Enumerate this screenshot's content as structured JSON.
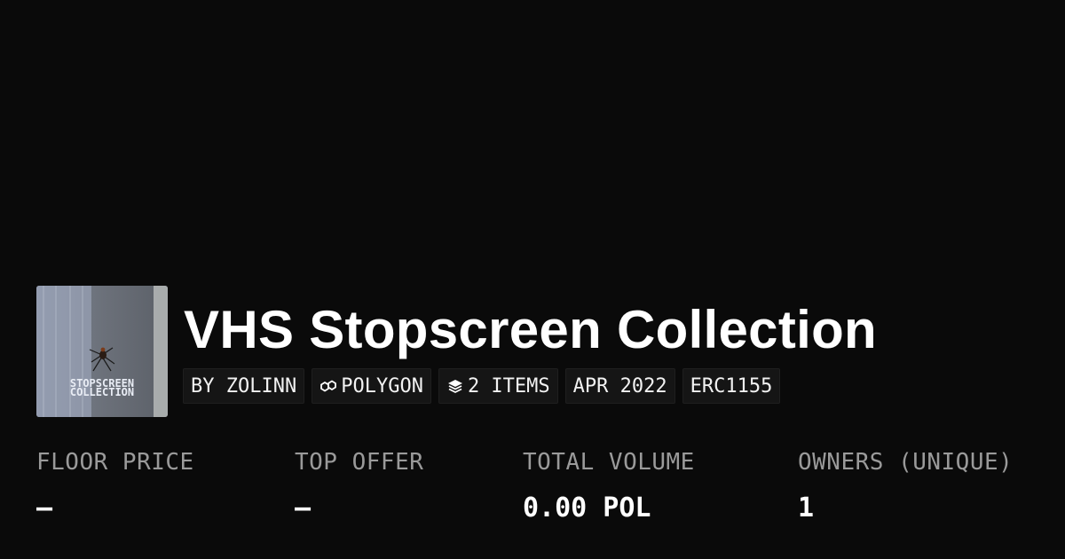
{
  "collection": {
    "title": "VHS Stopscreen Collection",
    "thumbnail_text": [
      "STOPSCREEN",
      "COLLECTION"
    ]
  },
  "chips": [
    {
      "label": "BY ZOLINN",
      "icon": ""
    },
    {
      "label": "POLYGON",
      "icon": "polygon-chain-icon"
    },
    {
      "label": "2 ITEMS",
      "icon": "layers-icon"
    },
    {
      "label": "APR 2022",
      "icon": ""
    },
    {
      "label": "ERC1155",
      "icon": ""
    }
  ],
  "stats": [
    {
      "label": "FLOOR PRICE",
      "value": "—"
    },
    {
      "label": "TOP OFFER",
      "value": "—"
    },
    {
      "label": "TOTAL VOLUME",
      "value": "0.00 POL"
    },
    {
      "label": "OWNERS (UNIQUE)",
      "value": "1"
    }
  ],
  "colors": {
    "background": "#0a0a0a",
    "chip_background": "#151515",
    "label_gray": "#9a9a9a",
    "text": "#ffffff"
  }
}
